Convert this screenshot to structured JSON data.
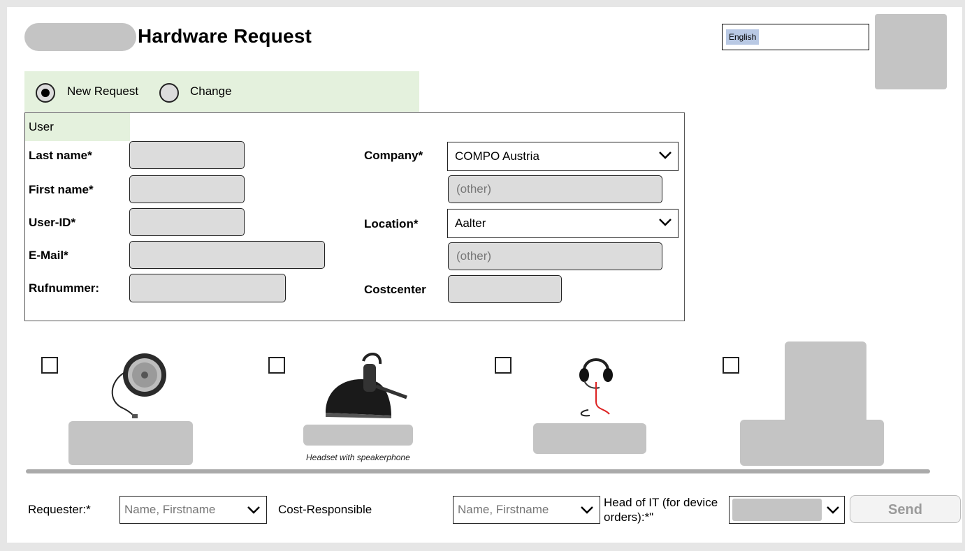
{
  "header": {
    "title": "Hardware Request",
    "language_value": "English"
  },
  "request_type": {
    "options": [
      {
        "label": "New Request",
        "selected": true
      },
      {
        "label": "Change",
        "selected": false
      }
    ]
  },
  "user_section": {
    "header": "User",
    "left_fields": {
      "last_name_label": "Last name*",
      "first_name_label": "First name*",
      "user_id_label": "User-ID*",
      "email_label": "E-Mail*",
      "phone_label": "Rufnummer:"
    },
    "right_fields": {
      "company_label": "Company*",
      "company_value": "COMPO Austria",
      "company_other_placeholder": "(other)",
      "location_label": "Location*",
      "location_value": "Aalter",
      "location_other_placeholder": "(other)",
      "costcenter_label": "Costcenter"
    }
  },
  "products": {
    "items": [
      {
        "icon": "speakerphone-icon",
        "checked": false
      },
      {
        "icon": "headset-speakerphone-icon",
        "checked": false,
        "caption": "Headset with speakerphone"
      },
      {
        "icon": "headset-icon",
        "checked": false
      },
      {
        "icon": "device-icon",
        "checked": false
      }
    ]
  },
  "footer": {
    "requester_label": "Requester:*",
    "requester_placeholder": "Name, Firstname",
    "cost_responsible_label": "Cost-Responsible",
    "cost_responsible_placeholder": "Name, Firstname",
    "head_of_it_label": "Head of IT (for device orders):*\"",
    "send_label": "Send"
  },
  "colors": {
    "panel_green": "#e4f1dd",
    "field_gray": "#dcdcdc",
    "chip_blue": "#b9c9e4",
    "redaction_gray": "#c4c4c4"
  }
}
